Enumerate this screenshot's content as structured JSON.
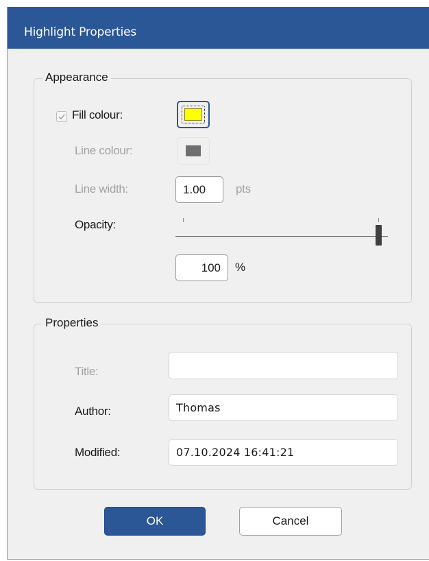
{
  "dialog": {
    "title": "Highlight Properties"
  },
  "appearance": {
    "legend": "Appearance",
    "fill_colour": {
      "label": "Fill colour:",
      "checked": true,
      "color": "#ffff00"
    },
    "line_colour": {
      "label": "Line colour:",
      "color": "#6f6f6f"
    },
    "line_width": {
      "label": "Line width:",
      "value": "1.00",
      "unit": "pts"
    },
    "opacity": {
      "label": "Opacity:",
      "value": "100",
      "unit": "%",
      "level_percent": 100
    }
  },
  "properties": {
    "legend": "Properties",
    "title": {
      "label": "Title:",
      "value": ""
    },
    "author": {
      "label": "Author:",
      "value": "Thomas"
    },
    "modified": {
      "label": "Modified:",
      "value": "07.10.2024 16:41:21"
    }
  },
  "buttons": {
    "ok": "OK",
    "cancel": "Cancel"
  },
  "colors": {
    "accent": "#2b5797",
    "disabled_text": "#a2a2a2"
  }
}
